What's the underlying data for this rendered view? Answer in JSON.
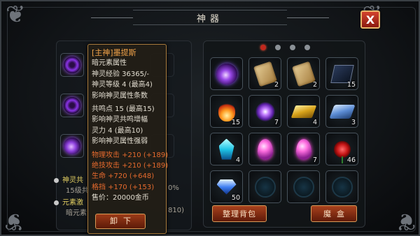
{
  "window": {
    "title": "神器"
  },
  "close_button": {
    "label": "X"
  },
  "left_panel": {
    "slots": [
      {
        "icon": "purple-vortex-icon"
      },
      {
        "icon": "purple-vortex-icon"
      },
      {
        "icon": "purple-swirl-icon"
      }
    ],
    "bg_lines": [
      {
        "text": "神灵共",
        "color": "#e4d062"
      },
      {
        "text": "15级共",
        "color": "#a6a095"
      },
      {
        "text": "元素激",
        "color": "#e4d062"
      },
      {
        "text": "暗元素",
        "color": "#a6a095"
      }
    ],
    "bg_right_fragments": [
      "0%",
      "810)"
    ]
  },
  "tooltip": {
    "name": "[主神]墨提斯",
    "lines": [
      "暗元素属性",
      "神灵经验  36365/-",
      "神灵等级  4  (最高4)",
      "影响神灵属性条数",
      "共鸣点  15  (最高15)",
      "影响神灵共鸣增幅",
      "灵力  4  (最高10)",
      "影响神灵属性强弱"
    ],
    "stats": [
      "物理攻击 +210  (+189)",
      "绝技攻击 +210  (+189)",
      "生命  +720  (+648)",
      "格挡  +170  (+153)"
    ],
    "price": "售价：20000金币",
    "unload_label": "卸下"
  },
  "inventory": {
    "page_dots": 4,
    "active_page": 0,
    "cells": [
      {
        "icon": "purple-orb-icon",
        "count": ""
      },
      {
        "icon": "scroll-icon",
        "count": "2"
      },
      {
        "icon": "scroll-icon",
        "count": "2"
      },
      {
        "icon": "dark-book-icon",
        "count": "15"
      },
      {
        "icon": "fire-icon",
        "count": "15"
      },
      {
        "icon": "purple-spark-icon",
        "count": "7"
      },
      {
        "icon": "gold-bar-icon",
        "count": "4"
      },
      {
        "icon": "blue-cloth-icon",
        "count": "3"
      },
      {
        "icon": "crystal-icon",
        "count": "4"
      },
      {
        "icon": "pink-egg-icon",
        "count": ""
      },
      {
        "icon": "pink-egg-icon",
        "count": "7"
      },
      {
        "icon": "rose-icon",
        "count": "46"
      },
      {
        "icon": "diamond-icon",
        "count": "50"
      },
      {
        "icon": "empty-slot-icon",
        "count": ""
      },
      {
        "icon": "empty-slot-icon",
        "count": ""
      },
      {
        "icon": "empty-slot-icon",
        "count": ""
      }
    ],
    "sort_label": "整理背包",
    "magic_box_label": "魔盒"
  }
}
